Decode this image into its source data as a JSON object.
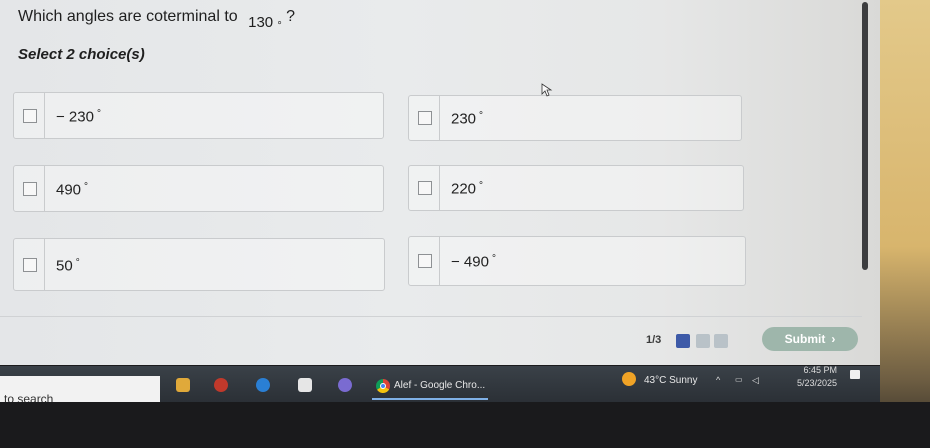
{
  "question": {
    "prefix": "Which angles are coterminal to",
    "value": "130",
    "degree_symbol": "°",
    "suffix": "?"
  },
  "instruction": "Select 2 choice(s)",
  "choices": [
    {
      "label": "− 230",
      "degree": "°",
      "checked": false
    },
    {
      "label": "230",
      "degree": "°",
      "checked": false
    },
    {
      "label": "490",
      "degree": "°",
      "checked": false
    },
    {
      "label": "220",
      "degree": "°",
      "checked": false
    },
    {
      "label": "50",
      "degree": "°",
      "checked": false
    },
    {
      "label": "− 490",
      "degree": "°",
      "checked": false
    }
  ],
  "footer": {
    "pager_text": "1/3",
    "submit_label": "Submit",
    "submit_chevron": "›"
  },
  "taskbar": {
    "search_text": "to search",
    "active_app_label": "Alef - Google Chro...",
    "weather": "43°C  Sunny",
    "clock_time": "6:45 PM",
    "clock_date": "5/23/2025"
  },
  "colors": {
    "submit_bg": "#9eb6ab",
    "active_dot": "#3d5aa8",
    "inactive_dot": "#b9c2c8"
  }
}
